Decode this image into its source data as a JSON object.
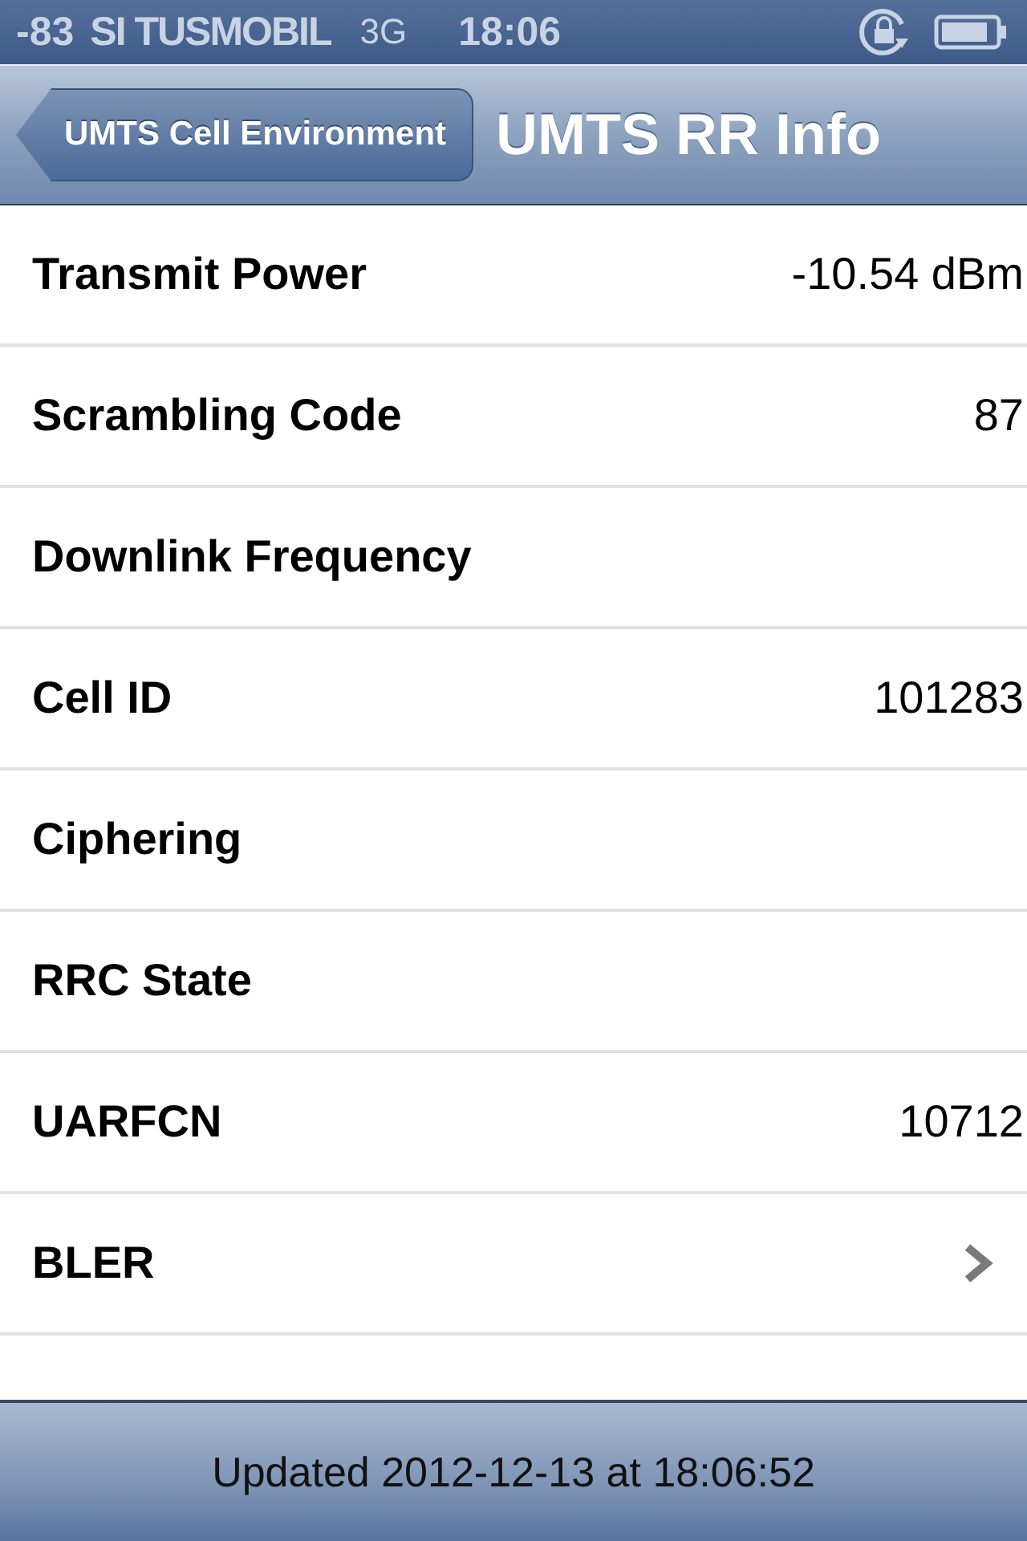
{
  "status_bar": {
    "signal": "-83",
    "carrier": "SI TUSMOBIL",
    "network": "3G",
    "time": "18:06"
  },
  "nav_bar": {
    "back_button": "UMTS Cell Environment",
    "title": "UMTS RR Info"
  },
  "rows": [
    {
      "kind": "value",
      "label": "Transmit Power",
      "value": "-10.54 dBm"
    },
    {
      "kind": "value",
      "label": "Scrambling Code",
      "value": "87"
    },
    {
      "kind": "value",
      "label": "Downlink Frequency"
    },
    {
      "kind": "value",
      "label": "Cell ID",
      "value": "101283"
    },
    {
      "kind": "value",
      "label": "Ciphering"
    },
    {
      "kind": "value",
      "label": "RRC State"
    },
    {
      "kind": "value",
      "label": "UARFCN",
      "value": "10712"
    },
    {
      "kind": "disclosure",
      "label": "BLER"
    }
  ],
  "toolbar": {
    "status": "Updated 2012-12-13 at 18:06:52"
  }
}
